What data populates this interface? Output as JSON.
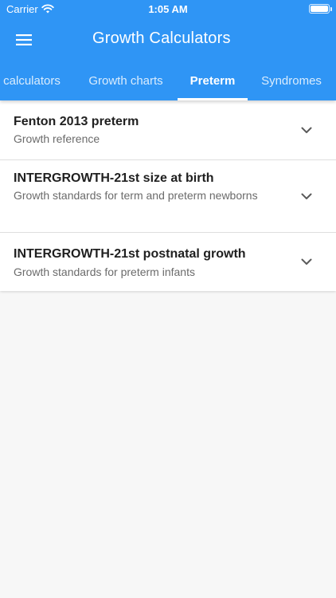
{
  "status_bar": {
    "carrier": "Carrier",
    "time": "1:05 AM",
    "wifi_icon": "wifi-icon",
    "battery_icon": "battery-icon"
  },
  "app_bar": {
    "title": "Growth Calculators",
    "menu_icon": "hamburger-menu-icon"
  },
  "tabs": [
    {
      "label": "calculators",
      "active": false
    },
    {
      "label": "Growth charts",
      "active": false
    },
    {
      "label": "Preterm",
      "active": true
    },
    {
      "label": "Syndromes",
      "active": false
    }
  ],
  "items": [
    {
      "title": "Fenton 2013 preterm",
      "subtitle": "Growth reference"
    },
    {
      "title": "INTERGROWTH-21st size at birth",
      "subtitle": "Growth standards for term and preterm newborns"
    },
    {
      "title": "INTERGROWTH-21st postnatal growth",
      "subtitle": "Growth standards for preterm infants"
    }
  ],
  "colors": {
    "primary": "#2f95f5",
    "background": "#f7f7f7",
    "title_text": "#202020",
    "subtitle_text": "#6b6b6b"
  }
}
